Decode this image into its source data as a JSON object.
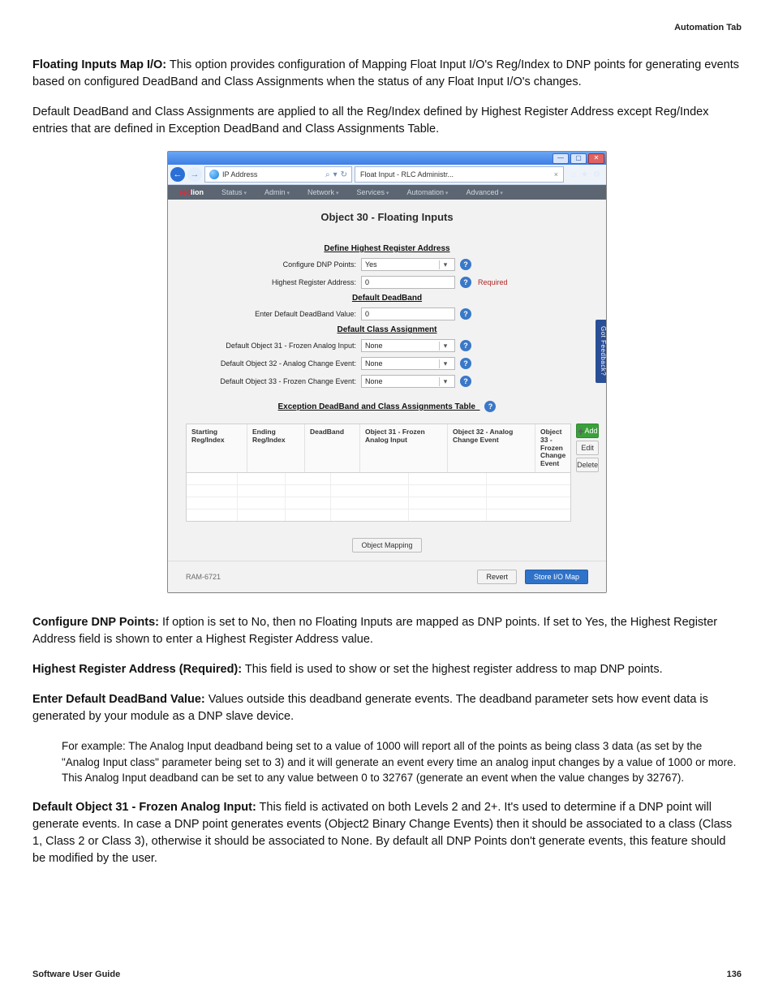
{
  "header": {
    "section": "Automation Tab"
  },
  "text": {
    "p1_bold": "Floating Inputs Map I/O:",
    "p1_rest": " This option provides configuration of Mapping Float Input I/O's Reg/Index to DNP points for generating events based on configured DeadBand and Class Assignments when the status of any Float Input I/O's changes.",
    "p2": "Default DeadBand and Class Assignments are applied to all the Reg/Index defined by Highest Register Address except Reg/Index entries that are defined in Exception DeadBand and Class Assignments Table.",
    "p3_bold": "Configure DNP Points:",
    "p3_rest": " If option is set to No, then no Floating Inputs are mapped as DNP points. If set to Yes, the Highest Register Address field is shown to enter a Highest Register Address value.",
    "p4_bold": "Highest Register Address (Required):",
    "p4_rest": " This field is used to show or set the highest register address to map DNP points.",
    "p5_bold": "Enter Default DeadBand Value:",
    "p5_rest": " Values outside this deadband generate events. The deadband parameter sets how event data is generated by your module as a DNP slave device.",
    "p6": "For example: The Analog Input deadband being set to a value of 1000 will report all of the points as being class 3 data (as set by the \"Analog Input class\" parameter being set to 3) and it will generate an event every time an analog input changes by a value of 1000 or more. This Analog Input deadband can be set to any value between 0 to 32767 (generate an event when the value changes by 32767).",
    "p7_bold": "Default Object 31 - Frozen Analog Input:",
    "p7_rest": " This field is activated on both Levels 2 and 2+. It's used to determine if a DNP point will generate events. In case a DNP point generates events (Object2 Binary Change Events) then it should be associated to a class (Class 1, Class 2 or Class 3), otherwise it should be associated to None. By default all DNP Points don't generate events, this feature should be modified by the user."
  },
  "footer": {
    "guide": "Software User Guide",
    "page": "136"
  },
  "shot": {
    "window": {
      "address_label": "IP Address",
      "tab_title": "Float Input - RLC Administr...",
      "icons": {
        "search": "⌕",
        "refresh": "↻",
        "home": "⌂",
        "star": "★",
        "gear": "⚙"
      }
    },
    "menu": {
      "logo_a": "red",
      "logo_b": "lion",
      "items": [
        "Status",
        "Admin",
        "Network",
        "Services",
        "Automation",
        "Advanced"
      ]
    },
    "page_title": "Object 30 - Floating Inputs",
    "sections": {
      "defhigh": "Define Highest Register Address",
      "defdead": "Default DeadBand",
      "defclass": "Default Class Assignment",
      "excep": "Exception DeadBand and Class Assignments Table"
    },
    "fields": {
      "cfg_label": "Configure DNP Points:",
      "cfg_value": "Yes",
      "hra_label": "Highest Register Address:",
      "hra_value": "0",
      "hra_req": "Required",
      "ddb_label": "Enter Default DeadBand Value:",
      "ddb_value": "0",
      "o31_label": "Default Object 31 - Frozen Analog Input:",
      "o31_value": "None",
      "o32_label": "Default Object 32 - Analog Change Event:",
      "o32_value": "None",
      "o33_label": "Default Object 33 - Frozen Change Event:",
      "o33_value": "None"
    },
    "table": {
      "cols": [
        "Starting Reg/Index",
        "Ending Reg/Index",
        "DeadBand",
        "Object 31 - Frozen Analog Input",
        "Object 32 - Analog Change Event",
        "Object 33 - Frozen Change Event"
      ],
      "btn_add": "Add",
      "btn_edit": "Edit",
      "btn_delete": "Delete"
    },
    "linkbtn": "Object Mapping",
    "model": "RAM-6721",
    "revert": "Revert",
    "store": "Store I/O Map",
    "feedback": "Got Feedback?"
  }
}
